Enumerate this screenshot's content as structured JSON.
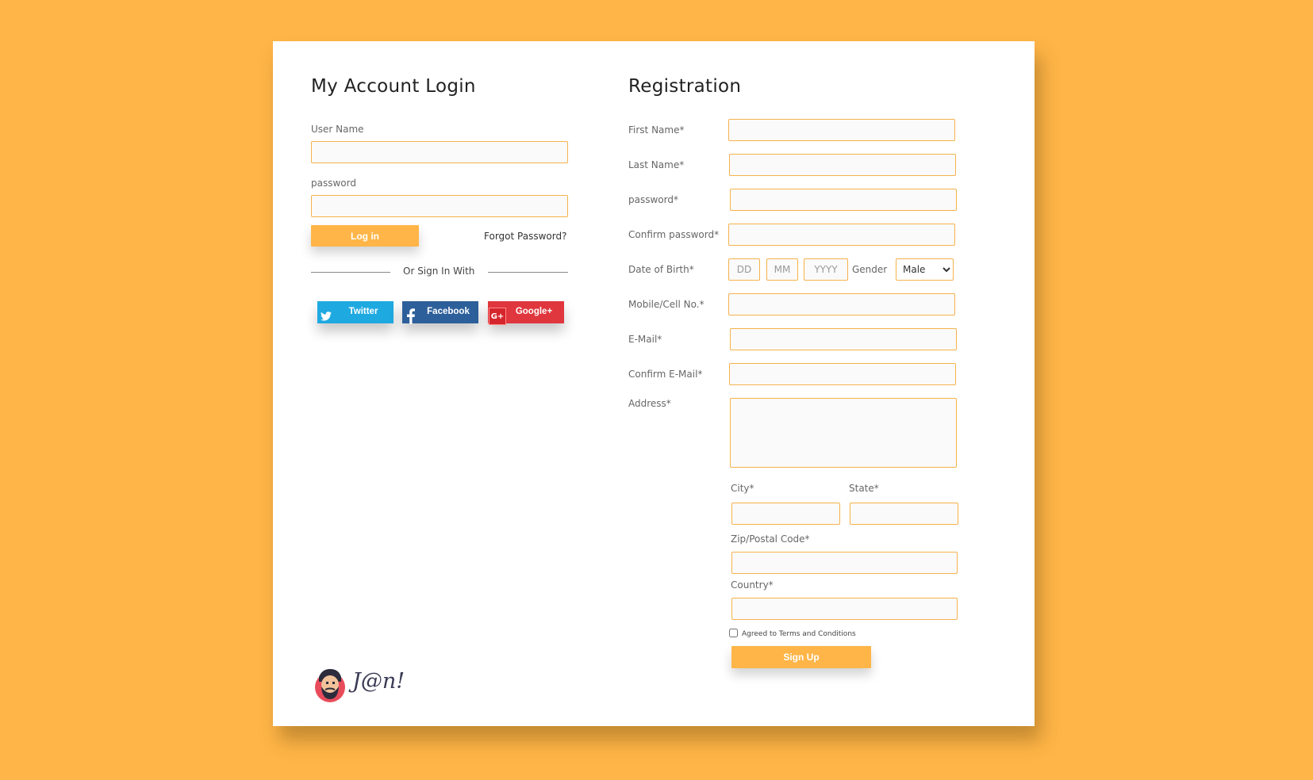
{
  "login": {
    "title": "My Account Login",
    "username_label": "User Name",
    "username_value": "",
    "password_label": "password",
    "password_value": "",
    "login_button": "Log in",
    "forgot_link": "Forgot Password?",
    "divider_text": "Or Sign In With",
    "social": [
      {
        "label": "Twitter",
        "color": "#1fa9e1",
        "icon": "twitter-icon"
      },
      {
        "label": "Facebook",
        "color": "#2d5f9a",
        "icon": "facebook-icon"
      },
      {
        "label": "Google+",
        "color": "#e0363d",
        "icon": "google-plus-icon"
      }
    ]
  },
  "registration": {
    "title": "Registration",
    "first_name_label": "First Name*",
    "last_name_label": "Last Name*",
    "password_label": "password*",
    "confirm_password_label": "Confirm password*",
    "dob_label": "Date of Birth*",
    "dob_day_placeholder": "DD",
    "dob_month_placeholder": "MM",
    "dob_year_placeholder": "YYYY",
    "gender_label": "Gender",
    "gender_value": "Male",
    "mobile_label": "Mobile/Cell No.*",
    "email_label": "E-Mail*",
    "confirm_email_label": "Confirm E-Mail*",
    "address_label": "Address*",
    "city_label": "City*",
    "state_label": "State*",
    "zip_label": "Zip/Postal Code*",
    "country_label": "Country*",
    "terms_label": "Agreed to Terms and Conditions",
    "terms_checked": false,
    "signup_button": "Sign Up"
  },
  "logo": {
    "text": "J@n!",
    "accent": "#e84c5b"
  }
}
